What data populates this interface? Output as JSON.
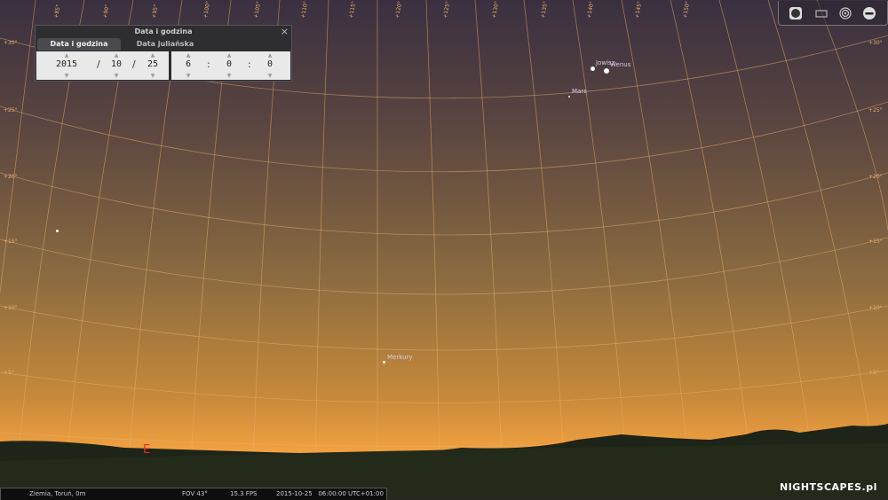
{
  "dialog": {
    "title": "Data i godzina",
    "tabs": [
      {
        "label": "Data i godzina",
        "active": true
      },
      {
        "label": "Data juliańska",
        "active": false
      }
    ],
    "date": {
      "year": "2015",
      "month": "10",
      "day": "25"
    },
    "time": {
      "hour": "6",
      "minute": "0",
      "second": "0"
    },
    "date_sep": "/",
    "time_sep": ":",
    "close_glyph": "×"
  },
  "sky": {
    "planets": [
      {
        "name": "Jowisz"
      },
      {
        "name": "Wenus"
      },
      {
        "name": "Mars"
      },
      {
        "name": "Merkury"
      }
    ],
    "cardinal": "E",
    "alt_labels": [
      "+30°",
      "+25°",
      "+20°",
      "+15°",
      "+10°",
      "+5°"
    ],
    "az_labels": [
      "+85°",
      "+90°",
      "+95°",
      "+100°",
      "+105°",
      "+110°",
      "+115°",
      "+120°",
      "+125°",
      "+130°",
      "+135°",
      "+140°",
      "+145°",
      "+150°"
    ]
  },
  "toolbar": {
    "icons": [
      "planet-icon",
      "display-icon",
      "target-icon",
      "minus-circle-icon"
    ]
  },
  "status": {
    "location": "Ziemia, Toruń, 0m",
    "fov": "FOV 43°",
    "fps": "15.3 FPS",
    "datetime": "2015-10-25   06:00:00 UTC+01:00"
  },
  "watermark": "NIGHTSCAPES.pl",
  "colors": {
    "grid": "#e8b070",
    "cardinal": "#e03020",
    "sky_top": "#3a3040",
    "horizon": "#f0a040"
  }
}
